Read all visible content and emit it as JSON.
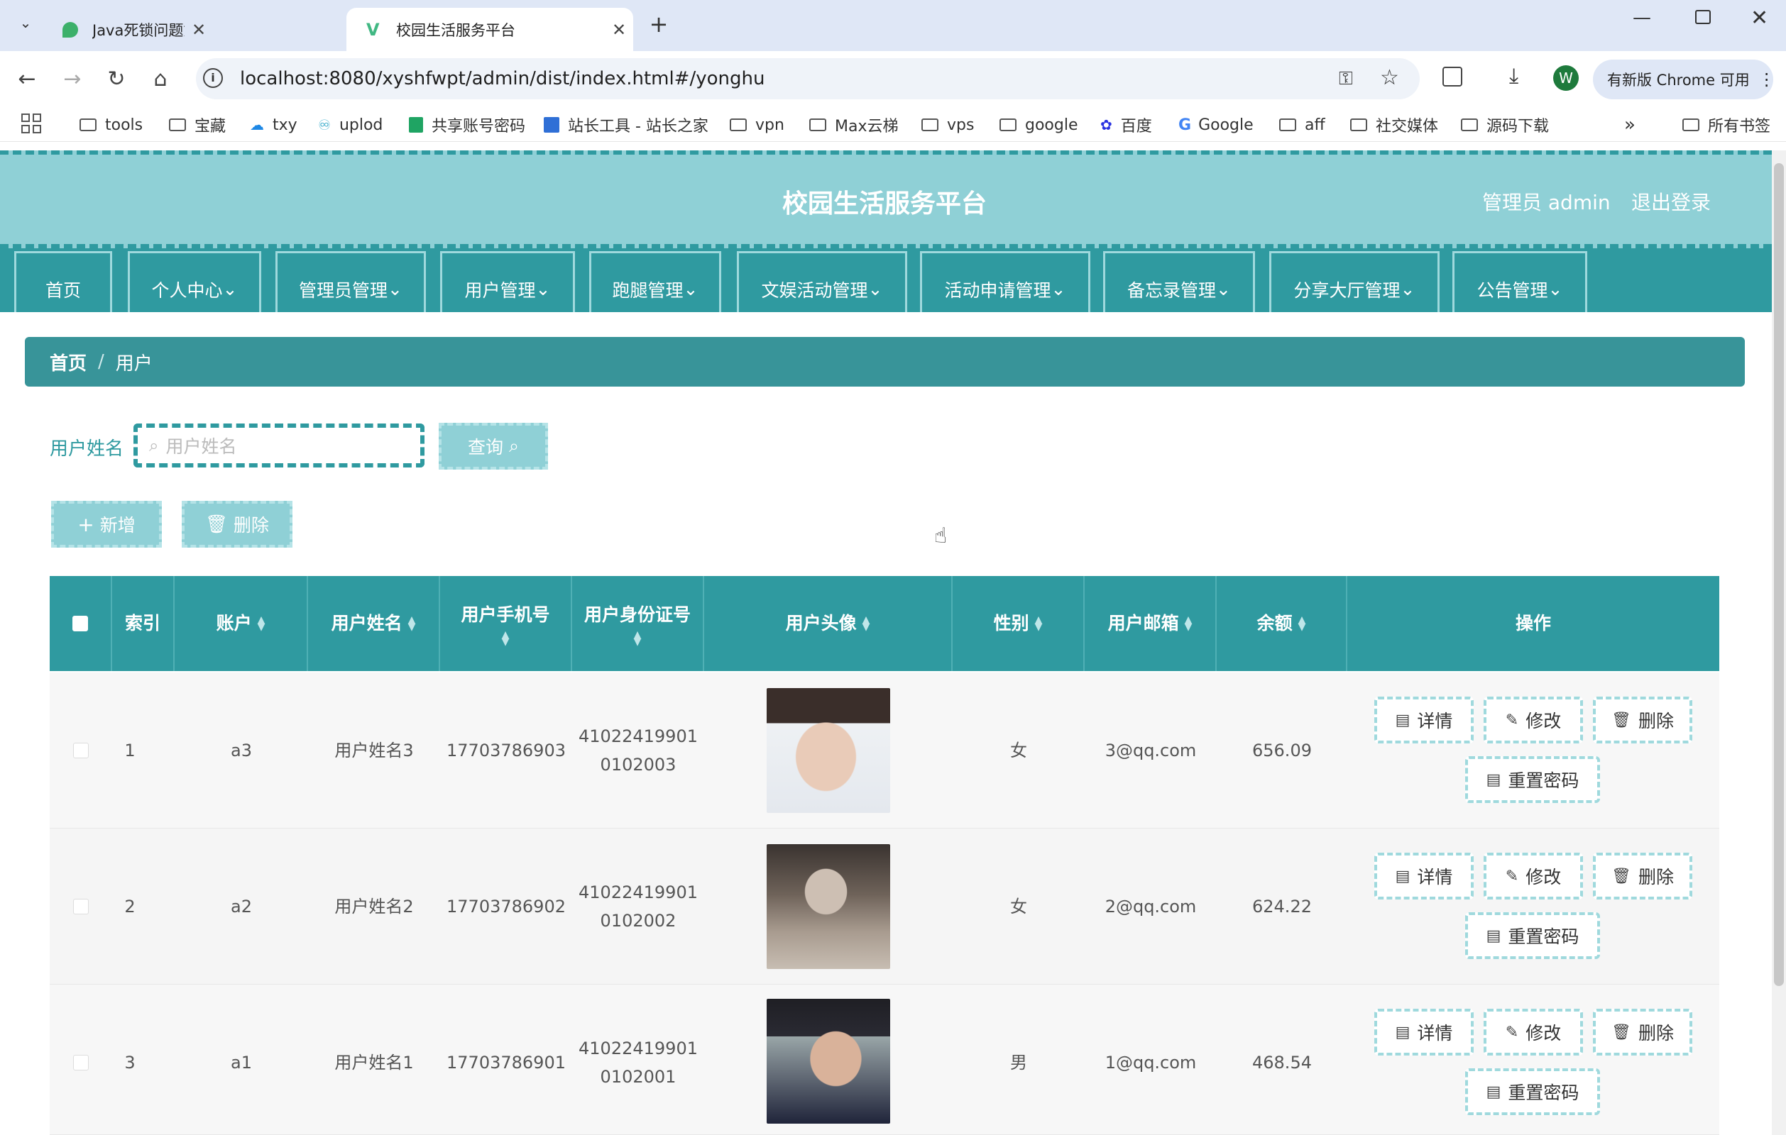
{
  "browser": {
    "tabs": [
      {
        "title": "Java死锁问题如何解决"
      },
      {
        "title": "校园生活服务平台"
      }
    ],
    "url": "localhost:8080/xyshfwpt/admin/dist/index.html#/yonghu",
    "update_label": "有新版 Chrome 可用",
    "profile_initial": "W",
    "bookmarks": [
      "tools",
      "宝藏",
      "txy",
      "uplod",
      "共享账号密码",
      "站长工具 - 站长之家",
      "vpn",
      "Max云梯",
      "vps",
      "google",
      "百度",
      "Google",
      "aff",
      "社交媒体",
      "源码下载"
    ],
    "all_bookmarks": "所有书签",
    "more": "»"
  },
  "app": {
    "title": "校园生活服务平台",
    "admin_label": "管理员 admin",
    "logout_label": "退出登录",
    "nav": [
      "首页",
      "个人中心",
      "管理员管理",
      "用户管理",
      "跑腿管理",
      "文娱活动管理",
      "活动申请管理",
      "备忘录管理",
      "分享大厅管理",
      "公告管理"
    ],
    "breadcrumb": {
      "home": "首页",
      "sep": "/",
      "current": "用户"
    },
    "search": {
      "label": "用户姓名",
      "placeholder": "用户姓名",
      "button": "查询"
    },
    "actions": {
      "add": "新增",
      "delete": "删除"
    },
    "table": {
      "headers": [
        "索引",
        "账户",
        "用户姓名",
        "用户手机号",
        "用户身份证号",
        "用户头像",
        "性别",
        "用户邮箱",
        "余额",
        "操作"
      ],
      "rows": [
        {
          "index": "1",
          "account": "a3",
          "name": "用户姓名3",
          "phone": "17703786903",
          "id1": "41022419901",
          "id2": "0102003",
          "gender": "女",
          "email": "3@qq.com",
          "balance": "656.09"
        },
        {
          "index": "2",
          "account": "a2",
          "name": "用户姓名2",
          "phone": "17703786902",
          "id1": "41022419901",
          "id2": "0102002",
          "gender": "女",
          "email": "2@qq.com",
          "balance": "624.22"
        },
        {
          "index": "3",
          "account": "a1",
          "name": "用户姓名1",
          "phone": "17703786901",
          "id1": "41022419901",
          "id2": "0102001",
          "gender": "男",
          "email": "1@qq.com",
          "balance": "468.54"
        }
      ],
      "row_actions": {
        "detail": "详情",
        "edit": "修改",
        "delete": "删除",
        "reset": "重置密码"
      }
    }
  },
  "colors": {
    "primary": "#2f9aa0",
    "light": "#8fd0d6",
    "breadcrumb": "#389499"
  }
}
